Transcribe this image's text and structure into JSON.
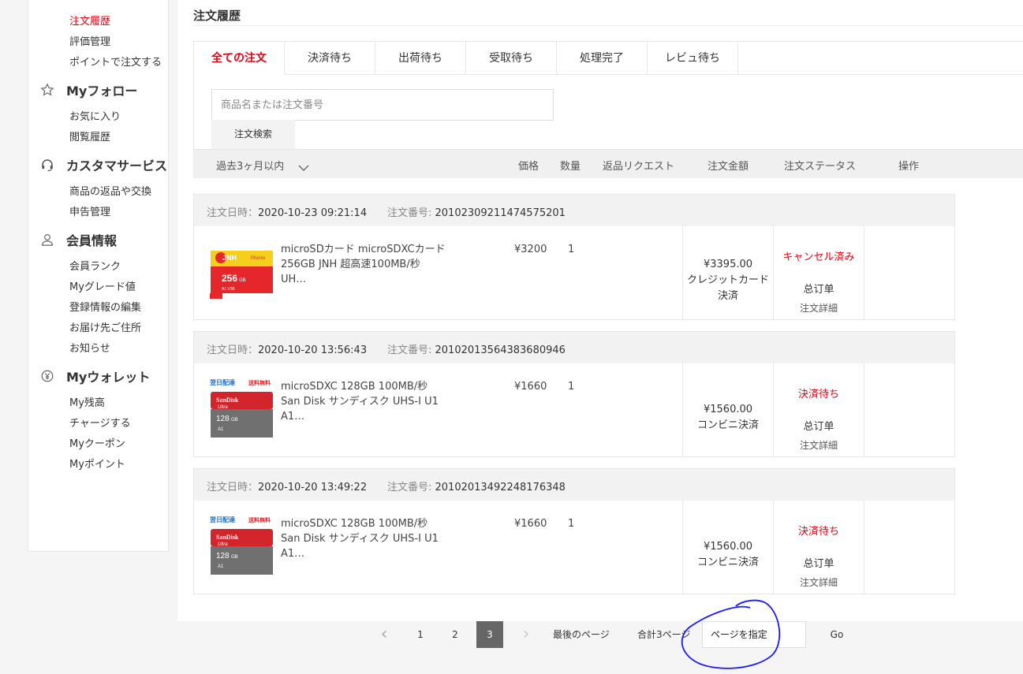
{
  "sidebar": {
    "top_items": [
      "注文履歴",
      "評価管理",
      "ポイントで注文する"
    ],
    "follow": {
      "heading": "Myフォロー",
      "items": [
        "お気に入り",
        "閲覧履歴"
      ]
    },
    "service": {
      "heading": "カスタマサービス",
      "items": [
        "商品の返品や交換",
        "申告管理"
      ]
    },
    "member": {
      "heading": "会員情報",
      "items": [
        "会員ランク",
        "Myグレード値",
        "登録情報の編集",
        "お届け先ご住所",
        "お知らせ"
      ]
    },
    "wallet": {
      "heading": "Myウォレット",
      "items": [
        "My残高",
        "チャージする",
        "Myクーポン",
        "Myポイント"
      ]
    }
  },
  "page_title": "注文履歴",
  "tabs": [
    "全ての注文",
    "決済待ち",
    "出荷待ち",
    "受取待ち",
    "処理完了",
    "レビュ待ち"
  ],
  "search": {
    "placeholder": "商品名または注文番号",
    "button": "注文検索"
  },
  "table_header": {
    "period": "過去3ヶ月以内",
    "price": "価格",
    "qty": "数量",
    "return": "返品リクエスト",
    "amount": "注文金額",
    "status": "注文ステータス",
    "action": "操作"
  },
  "labels": {
    "date": "注文日時：",
    "number": "注文番号: ",
    "summary": "总订单",
    "detail": "注文詳細"
  },
  "orders": [
    {
      "date": "2020-10-23 09:21:14",
      "number": "20102309211474575201",
      "name": "microSDカード microSDXCカード 256GB JNH 超高速100MB/秒 UH…",
      "price": "¥3200",
      "qty": "1",
      "total": "¥3395.00",
      "payment": "クレジットカード決済",
      "status": "キャンセル済み"
    },
    {
      "date": "2020-10-20 13:56:43",
      "number": "20102013564383680946",
      "name": "microSDXC 128GB 100MB/秒 San Disk サンディスク UHS-I U1 A1…",
      "price": "¥1660",
      "qty": "1",
      "total": "¥1560.00",
      "payment": "コンビニ決済",
      "status": "決済待ち"
    },
    {
      "date": "2020-10-20 13:49:22",
      "number": "20102013492248176348",
      "name": "microSDXC 128GB 100MB/秒 San Disk サンディスク UHS-I U1 A1…",
      "price": "¥1660",
      "qty": "1",
      "total": "¥1560.00",
      "payment": "コンビニ決済",
      "status": "決済待ち"
    }
  ],
  "thumbs": {
    "jnh": {
      "brand": "JNH",
      "sub": "Phenix",
      "cap": "256",
      "unit": "GB",
      "extra": "A1 V30"
    },
    "sandisk": {
      "badge1": "翌日配達",
      "badge2": "送料無料",
      "brand": "SanDisk",
      "sub": "Ultra",
      "cap": "128",
      "unit": "GB",
      "extra": "A1"
    }
  },
  "pagination": {
    "prev": "‹",
    "pages": [
      "1",
      "2",
      "3"
    ],
    "current": "3",
    "next": "›",
    "last": "最後のページ",
    "total": "合計3ページ",
    "input_placeholder": "ページを指定",
    "go": "Go"
  },
  "colors": {
    "accent": "#e60012",
    "annotation": "#1a1aff"
  }
}
